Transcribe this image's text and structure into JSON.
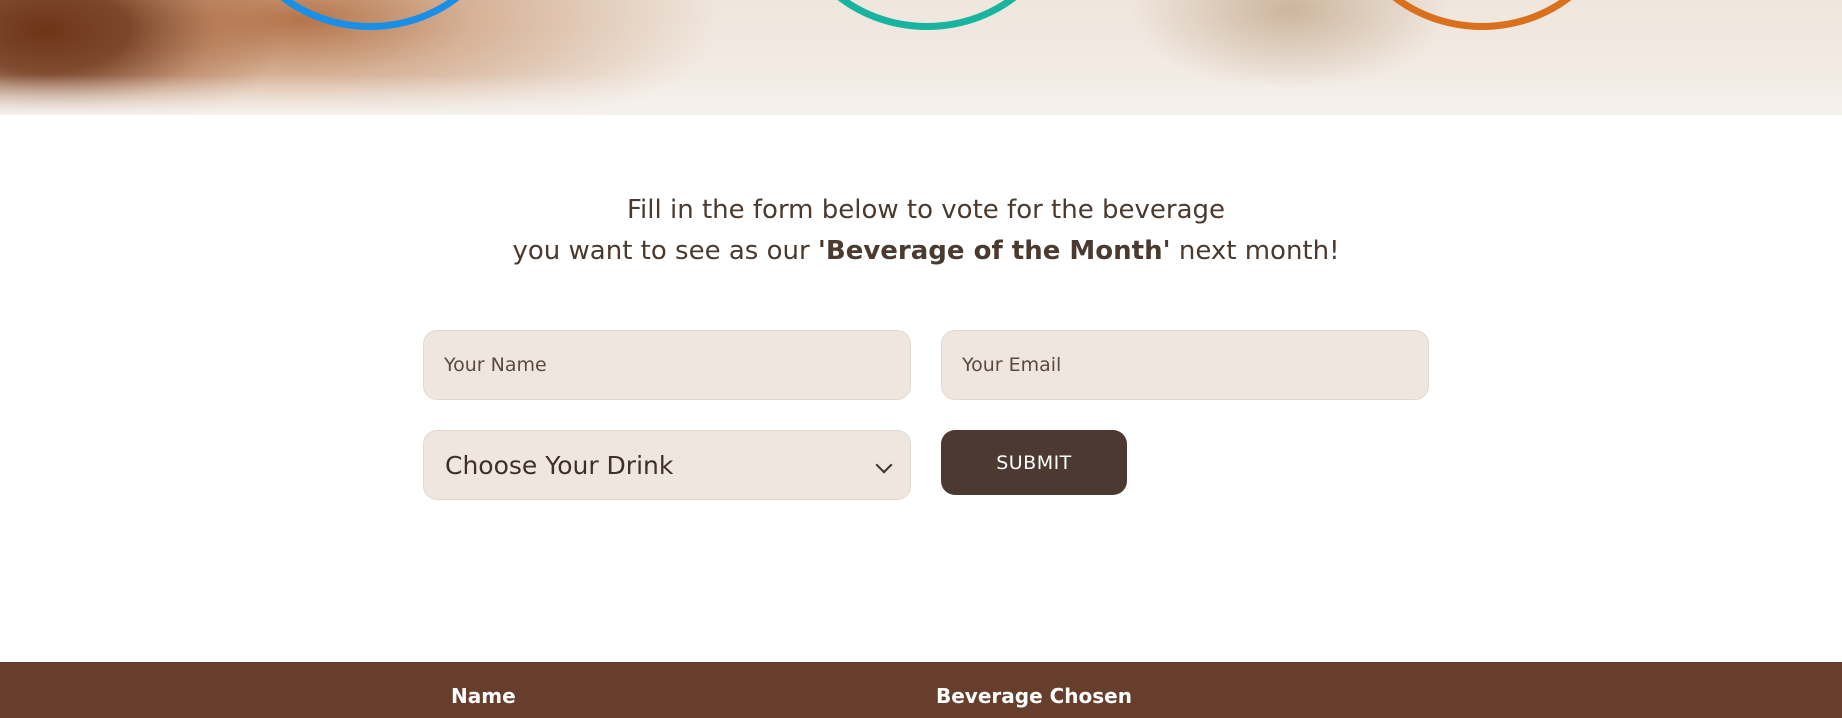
{
  "hero": {
    "rings": [
      "blue-ring",
      "gradient-ring",
      "orange-ring"
    ]
  },
  "intro": {
    "line1": "Fill in the form below to vote for the beverage",
    "line2_prefix": "you want to see as our ",
    "line2_bold": "'Beverage of the Month'",
    "line2_suffix": " next month!"
  },
  "form": {
    "name_placeholder": "Your Name",
    "email_placeholder": "Your Email",
    "drink_select_label": "Choose Your Drink",
    "submit_label": "SUBMIT"
  },
  "table": {
    "columns": [
      "Name",
      "Beverage Chosen"
    ]
  },
  "colors": {
    "field_bg": "#efe6df",
    "button_bg": "#4c3a32",
    "table_header_bg": "#673d2c",
    "text": "#4a3a30"
  }
}
